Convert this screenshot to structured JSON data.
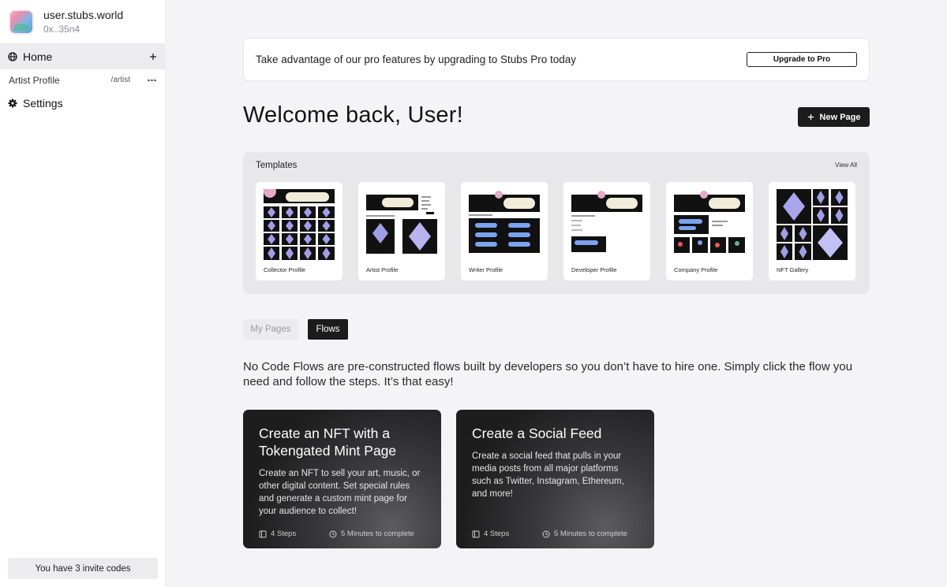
{
  "account": {
    "name": "user.stubs.world",
    "address": "0x..35n4"
  },
  "sidebar": {
    "home": {
      "label": "Home",
      "icon": "globe-icon",
      "action_icon": "plus-icon"
    },
    "pages": [
      {
        "label": "Artist Profile",
        "slug": "/artist",
        "icon": "more-horizontal-icon"
      }
    ],
    "settings": {
      "label": "Settings",
      "icon": "gear-icon"
    },
    "invite": "You have 3 invite codes"
  },
  "promo": {
    "text": "Take advantage of our pro features by upgrading to Stubs Pro today",
    "button": "Upgrade to Pro"
  },
  "welcome": "Welcome back, User!",
  "new_page": {
    "label": "New Page",
    "icon": "plus-icon"
  },
  "templates": {
    "title": "Templates",
    "view_all": "View All",
    "items": [
      {
        "name": "Collector Profile"
      },
      {
        "name": "Artist Profile"
      },
      {
        "name": "Writer Profile"
      },
      {
        "name": "Developer Profile"
      },
      {
        "name": "Company Profile"
      },
      {
        "name": "NFT Gallery"
      }
    ]
  },
  "tabs": {
    "my_pages": "My Pages",
    "flows": "Flows",
    "active": "Flows"
  },
  "flows_description": "No Code Flows are pre-constructed flows built by developers so you don’t have to hire one. Simply click the flow you need and follow the steps. It’s that easy!",
  "flows": [
    {
      "title": "Create an NFT with a Tokengated Mint Page",
      "description": "Create an NFT to sell your art, music, or other digital content. Set special rules and generate a custom mint page for your audience to collect!",
      "steps": "4 Steps",
      "time": "5 Minutes to complete"
    },
    {
      "title": "Create a Social Feed",
      "description": "Create a social feed that pulls in your media posts from all major platforms such as Twitter, Instagram, Ethereum, and more!",
      "steps": "4 Steps",
      "time": "5 Minutes to complete"
    }
  ],
  "colors": {
    "dark": "#1b1b1b",
    "background": "#f4f4f6",
    "panel": "#e8e8eb"
  }
}
